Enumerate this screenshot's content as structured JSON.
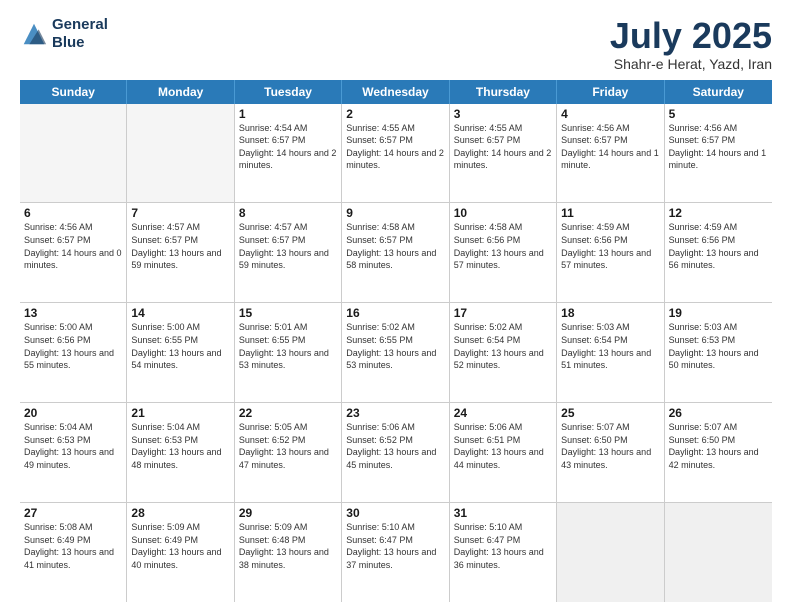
{
  "logo": {
    "line1": "General",
    "line2": "Blue"
  },
  "title": "July 2025",
  "subtitle": "Shahr-e Herat, Yazd, Iran",
  "days": [
    "Sunday",
    "Monday",
    "Tuesday",
    "Wednesday",
    "Thursday",
    "Friday",
    "Saturday"
  ],
  "weeks": [
    [
      {
        "day": "",
        "empty": true
      },
      {
        "day": "",
        "empty": true
      },
      {
        "day": "1",
        "sunrise": "Sunrise: 4:54 AM",
        "sunset": "Sunset: 6:57 PM",
        "daylight": "Daylight: 14 hours and 2 minutes."
      },
      {
        "day": "2",
        "sunrise": "Sunrise: 4:55 AM",
        "sunset": "Sunset: 6:57 PM",
        "daylight": "Daylight: 14 hours and 2 minutes."
      },
      {
        "day": "3",
        "sunrise": "Sunrise: 4:55 AM",
        "sunset": "Sunset: 6:57 PM",
        "daylight": "Daylight: 14 hours and 2 minutes."
      },
      {
        "day": "4",
        "sunrise": "Sunrise: 4:56 AM",
        "sunset": "Sunset: 6:57 PM",
        "daylight": "Daylight: 14 hours and 1 minute."
      },
      {
        "day": "5",
        "sunrise": "Sunrise: 4:56 AM",
        "sunset": "Sunset: 6:57 PM",
        "daylight": "Daylight: 14 hours and 1 minute."
      }
    ],
    [
      {
        "day": "6",
        "sunrise": "Sunrise: 4:56 AM",
        "sunset": "Sunset: 6:57 PM",
        "daylight": "Daylight: 14 hours and 0 minutes."
      },
      {
        "day": "7",
        "sunrise": "Sunrise: 4:57 AM",
        "sunset": "Sunset: 6:57 PM",
        "daylight": "Daylight: 13 hours and 59 minutes."
      },
      {
        "day": "8",
        "sunrise": "Sunrise: 4:57 AM",
        "sunset": "Sunset: 6:57 PM",
        "daylight": "Daylight: 13 hours and 59 minutes."
      },
      {
        "day": "9",
        "sunrise": "Sunrise: 4:58 AM",
        "sunset": "Sunset: 6:57 PM",
        "daylight": "Daylight: 13 hours and 58 minutes."
      },
      {
        "day": "10",
        "sunrise": "Sunrise: 4:58 AM",
        "sunset": "Sunset: 6:56 PM",
        "daylight": "Daylight: 13 hours and 57 minutes."
      },
      {
        "day": "11",
        "sunrise": "Sunrise: 4:59 AM",
        "sunset": "Sunset: 6:56 PM",
        "daylight": "Daylight: 13 hours and 57 minutes."
      },
      {
        "day": "12",
        "sunrise": "Sunrise: 4:59 AM",
        "sunset": "Sunset: 6:56 PM",
        "daylight": "Daylight: 13 hours and 56 minutes."
      }
    ],
    [
      {
        "day": "13",
        "sunrise": "Sunrise: 5:00 AM",
        "sunset": "Sunset: 6:56 PM",
        "daylight": "Daylight: 13 hours and 55 minutes."
      },
      {
        "day": "14",
        "sunrise": "Sunrise: 5:00 AM",
        "sunset": "Sunset: 6:55 PM",
        "daylight": "Daylight: 13 hours and 54 minutes."
      },
      {
        "day": "15",
        "sunrise": "Sunrise: 5:01 AM",
        "sunset": "Sunset: 6:55 PM",
        "daylight": "Daylight: 13 hours and 53 minutes."
      },
      {
        "day": "16",
        "sunrise": "Sunrise: 5:02 AM",
        "sunset": "Sunset: 6:55 PM",
        "daylight": "Daylight: 13 hours and 53 minutes."
      },
      {
        "day": "17",
        "sunrise": "Sunrise: 5:02 AM",
        "sunset": "Sunset: 6:54 PM",
        "daylight": "Daylight: 13 hours and 52 minutes."
      },
      {
        "day": "18",
        "sunrise": "Sunrise: 5:03 AM",
        "sunset": "Sunset: 6:54 PM",
        "daylight": "Daylight: 13 hours and 51 minutes."
      },
      {
        "day": "19",
        "sunrise": "Sunrise: 5:03 AM",
        "sunset": "Sunset: 6:53 PM",
        "daylight": "Daylight: 13 hours and 50 minutes."
      }
    ],
    [
      {
        "day": "20",
        "sunrise": "Sunrise: 5:04 AM",
        "sunset": "Sunset: 6:53 PM",
        "daylight": "Daylight: 13 hours and 49 minutes."
      },
      {
        "day": "21",
        "sunrise": "Sunrise: 5:04 AM",
        "sunset": "Sunset: 6:53 PM",
        "daylight": "Daylight: 13 hours and 48 minutes."
      },
      {
        "day": "22",
        "sunrise": "Sunrise: 5:05 AM",
        "sunset": "Sunset: 6:52 PM",
        "daylight": "Daylight: 13 hours and 47 minutes."
      },
      {
        "day": "23",
        "sunrise": "Sunrise: 5:06 AM",
        "sunset": "Sunset: 6:52 PM",
        "daylight": "Daylight: 13 hours and 45 minutes."
      },
      {
        "day": "24",
        "sunrise": "Sunrise: 5:06 AM",
        "sunset": "Sunset: 6:51 PM",
        "daylight": "Daylight: 13 hours and 44 minutes."
      },
      {
        "day": "25",
        "sunrise": "Sunrise: 5:07 AM",
        "sunset": "Sunset: 6:50 PM",
        "daylight": "Daylight: 13 hours and 43 minutes."
      },
      {
        "day": "26",
        "sunrise": "Sunrise: 5:07 AM",
        "sunset": "Sunset: 6:50 PM",
        "daylight": "Daylight: 13 hours and 42 minutes."
      }
    ],
    [
      {
        "day": "27",
        "sunrise": "Sunrise: 5:08 AM",
        "sunset": "Sunset: 6:49 PM",
        "daylight": "Daylight: 13 hours and 41 minutes."
      },
      {
        "day": "28",
        "sunrise": "Sunrise: 5:09 AM",
        "sunset": "Sunset: 6:49 PM",
        "daylight": "Daylight: 13 hours and 40 minutes."
      },
      {
        "day": "29",
        "sunrise": "Sunrise: 5:09 AM",
        "sunset": "Sunset: 6:48 PM",
        "daylight": "Daylight: 13 hours and 38 minutes."
      },
      {
        "day": "30",
        "sunrise": "Sunrise: 5:10 AM",
        "sunset": "Sunset: 6:47 PM",
        "daylight": "Daylight: 13 hours and 37 minutes."
      },
      {
        "day": "31",
        "sunrise": "Sunrise: 5:10 AM",
        "sunset": "Sunset: 6:47 PM",
        "daylight": "Daylight: 13 hours and 36 minutes."
      },
      {
        "day": "",
        "empty": true,
        "shaded": true
      },
      {
        "day": "",
        "empty": true,
        "shaded": true
      }
    ]
  ]
}
